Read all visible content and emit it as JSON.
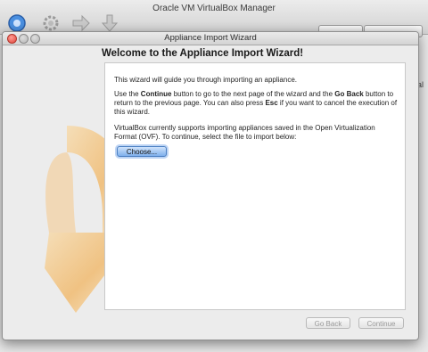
{
  "manager": {
    "title": "Oracle VM VirtualBox Manager",
    "toolbar_icons": [
      "new-machine-icon",
      "settings-gear-icon",
      "start-arrow-icon",
      "discard-arrow-icon"
    ]
  },
  "wizard": {
    "window_title": "Appliance Import Wizard",
    "heading": "Welcome to the Appliance Import Wizard!",
    "paragraph1": "This wizard will guide you through importing an appliance.",
    "paragraph2": {
      "t1": "Use the ",
      "b1": "Continue",
      "t2": " button to go to the next page of the wizard and the ",
      "b2": "Go Back",
      "t3": " button to return to the previous page. You can also press ",
      "b3": "Esc",
      "t4": " if you want to cancel the execution of this wizard."
    },
    "paragraph3": "VirtualBox currently supports importing appliances saved in the Open Virtualization Format (OVF). To continue, select the file to import below:",
    "choose_label": "Choose...",
    "go_back_label": "Go Back",
    "continue_label": "Continue",
    "watermark_icon": "import-arrow-icon"
  },
  "colors": {
    "accent": "#5b93dd",
    "watermark": "#f3b25d"
  }
}
